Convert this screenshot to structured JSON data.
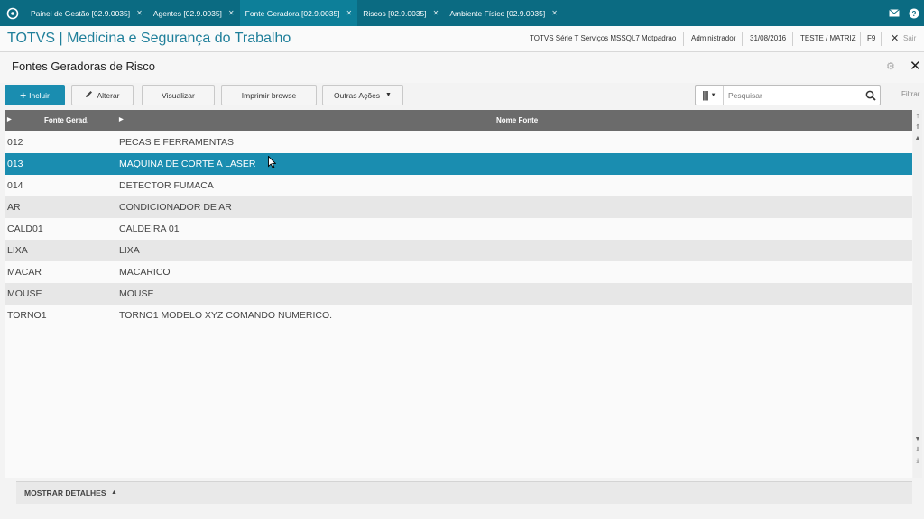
{
  "tabs": [
    {
      "label": "Painel de Gestão [02.9.0035]",
      "active": false
    },
    {
      "label": "Agentes [02.9.0035]",
      "active": false
    },
    {
      "label": "Fonte Geradora [02.9.0035]",
      "active": true
    },
    {
      "label": "Riscos [02.9.0035]",
      "active": false
    },
    {
      "label": "Ambiente Físico [02.9.0035]",
      "active": false
    }
  ],
  "header": {
    "title": "TOTVS | Medicina e Segurança do Trabalho",
    "environment": "TOTVS Série T Serviços MSSQL7 Mdtpadrao",
    "user": "Administrador",
    "date": "31/08/2016",
    "branch": "TESTE / MATRIZ",
    "shortcut": "F9",
    "exit_label": "Sair"
  },
  "page": {
    "title": "Fontes Geradoras de Risco"
  },
  "toolbar": {
    "include_label": "Incluir",
    "edit_label": "Alterar",
    "view_label": "Visualizar",
    "print_label": "Imprimir browse",
    "other_label": "Outras Ações",
    "search_placeholder": "Pesquisar",
    "filter_label": "Filtrar"
  },
  "grid": {
    "columns": [
      "Fonte Gerad.",
      "Nome Fonte"
    ],
    "rows": [
      [
        "012",
        "PECAS E FERRAMENTAS"
      ],
      [
        "013",
        "MAQUINA DE CORTE A LASER"
      ],
      [
        "014",
        "DETECTOR FUMACA"
      ],
      [
        "AR",
        "CONDICIONADOR DE AR"
      ],
      [
        "CALD01",
        "CALDEIRA 01"
      ],
      [
        "LIXA",
        "LIXA"
      ],
      [
        "MACAR",
        "MACARICO"
      ],
      [
        "MOUSE",
        "MOUSE"
      ],
      [
        "TORNO1",
        "TORNO1  MODELO XYZ COMANDO NUMERICO."
      ]
    ],
    "selected_index": 1
  },
  "footer": {
    "details_label": "MOSTRAR DETALHES"
  },
  "colors": {
    "topbar": "#0b6b82",
    "accent": "#1a8db0",
    "grid_header": "#6b6b6b"
  }
}
